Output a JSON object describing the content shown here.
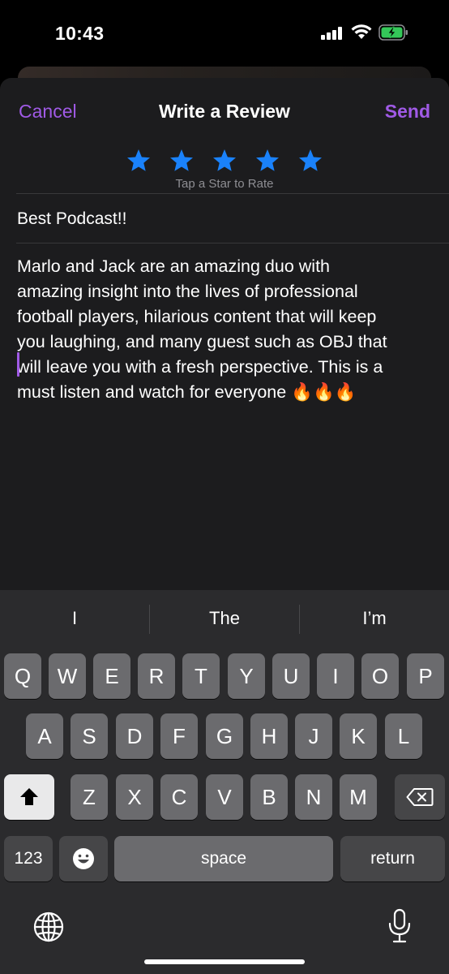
{
  "status_bar": {
    "time": "10:43"
  },
  "nav": {
    "cancel_label": "Cancel",
    "title": "Write a Review",
    "send_label": "Send"
  },
  "rating": {
    "stars": 5,
    "max_stars": 5,
    "hint": "Tap a Star to Rate"
  },
  "review": {
    "title": "Best Podcast!!",
    "body_lines": [
      "Marlo and Jack are an amazing duo with",
      "amazing insight into the lives of professional",
      "football players, hilarious content that will keep",
      "you laughing, and many guest such as OBJ that",
      "will leave you with a fresh perspective. This is a",
      "must listen and watch for everyone 🔥🔥🔥"
    ]
  },
  "keyboard": {
    "suggestions": [
      "I",
      "The",
      "I’m"
    ],
    "row1": [
      "Q",
      "W",
      "E",
      "R",
      "T",
      "Y",
      "U",
      "I",
      "O",
      "P"
    ],
    "row2": [
      "A",
      "S",
      "D",
      "F",
      "G",
      "H",
      "J",
      "K",
      "L"
    ],
    "row3": [
      "Z",
      "X",
      "C",
      "V",
      "B",
      "N",
      "M"
    ],
    "numbers_label": "123",
    "space_label": "space",
    "return_label": "return"
  },
  "colors": {
    "accent": "#a05ae6",
    "star": "#1a82fb",
    "background": "#1c1c1e"
  }
}
